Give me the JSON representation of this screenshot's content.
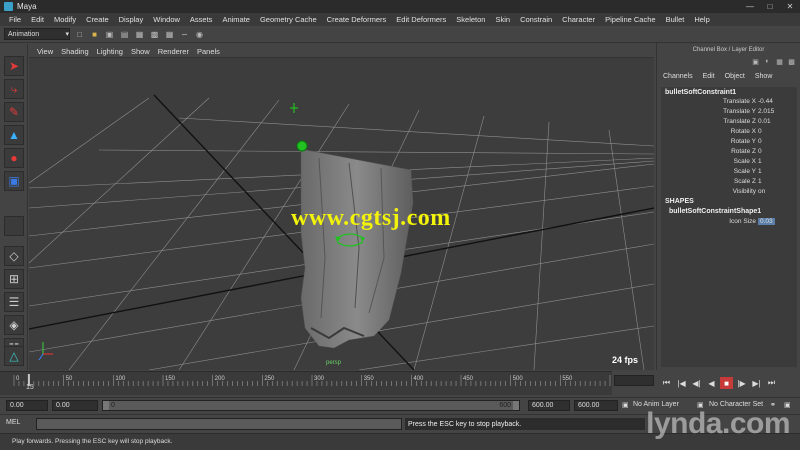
{
  "window": {
    "title": "Maya"
  },
  "menubar": [
    "File",
    "Edit",
    "Modify",
    "Create",
    "Display",
    "Window",
    "Assets",
    "Animate",
    "Geometry Cache",
    "Create Deformers",
    "Edit Deformers",
    "Skeleton",
    "Skin",
    "Constrain",
    "Character",
    "Pipeline Cache",
    "Bullet",
    "Help"
  ],
  "toolbar": {
    "mode": "Animation"
  },
  "viewport": {
    "menu": [
      "View",
      "Shading",
      "Lighting",
      "Show",
      "Renderer",
      "Panels"
    ],
    "fps": "24 fps",
    "camera": "persp",
    "watermark": "www.cgtsj.com"
  },
  "channelbox": {
    "title": "Channel Box / Layer Editor",
    "menu": [
      "Channels",
      "Edit",
      "Object",
      "Show"
    ],
    "object": "bulletSoftConstraint1",
    "attributes": [
      {
        "label": "Translate X",
        "value": "-0.44"
      },
      {
        "label": "Translate Y",
        "value": "2.015"
      },
      {
        "label": "Translate Z",
        "value": "0.01"
      },
      {
        "label": "Rotate X",
        "value": "0"
      },
      {
        "label": "Rotate Y",
        "value": "0"
      },
      {
        "label": "Rotate Z",
        "value": "0"
      },
      {
        "label": "Scale X",
        "value": "1"
      },
      {
        "label": "Scale Y",
        "value": "1"
      },
      {
        "label": "Scale Z",
        "value": "1"
      },
      {
        "label": "Visibility",
        "value": "on"
      }
    ],
    "shapes_header": "SHAPES",
    "shape_name": "bulletSoftConstraintShape1",
    "shape_attr": {
      "label": "Icon Size",
      "value": "0.03"
    }
  },
  "timeline": {
    "ticks": [
      "0",
      "50",
      "100",
      "150",
      "200",
      "250",
      "300",
      "350",
      "400",
      "450",
      "500",
      "550",
      "60"
    ],
    "current_frame": "15"
  },
  "range": {
    "start": "0.00",
    "playback_start": "0.00",
    "slider_left": "0",
    "slider_right": "600",
    "playback_end": "600.00",
    "end": "600.00",
    "anim_layer": "No Anim Layer",
    "character_set": "No Character Set"
  },
  "command": {
    "mel_label": "MEL",
    "result": "Press the ESC key to stop playback."
  },
  "help": {
    "text": "Play forwards. Pressing the ESC key will stop playback."
  },
  "branding": {
    "logo": "lynda.com"
  },
  "colors": {
    "accent_yellow": "#f2f20a",
    "grid_green": "#1db81d",
    "active_red": "#c63a3a",
    "selected_blue": "#5b7fa8"
  }
}
